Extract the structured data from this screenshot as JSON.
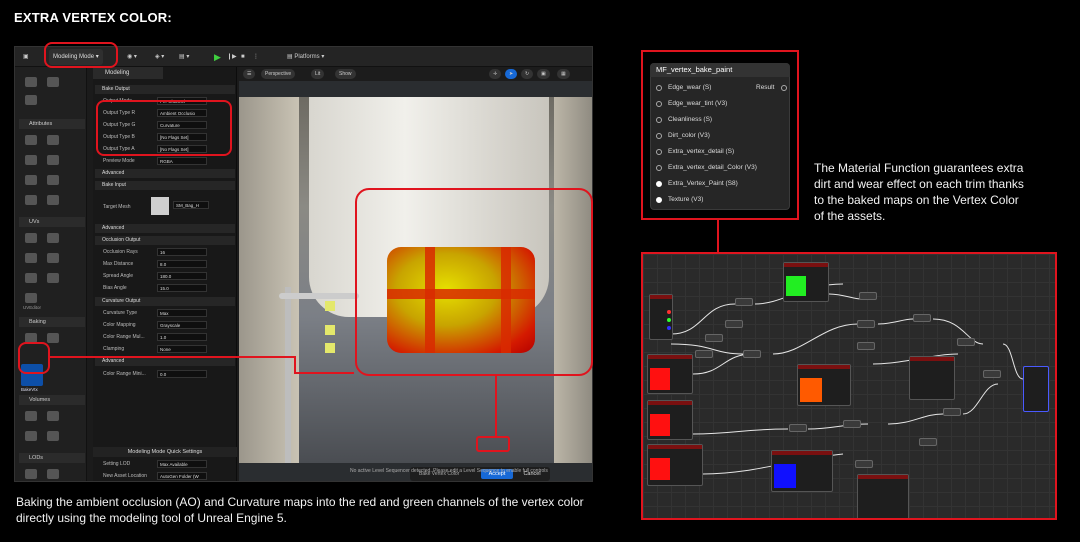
{
  "title": "EXTRA VERTEX COLOR:",
  "captions": {
    "bottom": "Baking the ambient occlusion (AO) and Curvature maps into the red and green channels of the vertex color directly using the modeling tool of Unreal Engine 5.",
    "right": "The Material Function guarantees extra dirt and wear effect on each trim thanks to the baked maps on the Vertex Color of the assets."
  },
  "toolbar": {
    "mode": "Modeling Mode",
    "platforms": "Platforms"
  },
  "modes_panel": {
    "groups": [
      "Attributes",
      "UVs",
      "Baking",
      "Volumes",
      "LODs"
    ],
    "active_tool": "BakeVtx",
    "tool_labels": {
      "unwrap": "UVEditor"
    }
  },
  "modeling_panel": {
    "tab": "Modeling",
    "sections": {
      "bake_output": "Bake Output",
      "advanced1": "Advanced",
      "bake_input": "Bake Input",
      "advanced2": "Advanced",
      "occlusion_output": "Occlusion Output",
      "curvature_output": "Curvature Output",
      "advanced3": "Advanced"
    },
    "rows": {
      "output_mode": {
        "label": "Output Mode",
        "value": "Per Channel"
      },
      "output_type_r": {
        "label": "Output Type R",
        "value": "Ambient Occlusio"
      },
      "output_type_g": {
        "label": "Output Type G",
        "value": "Curvature"
      },
      "output_type_b": {
        "label": "Output Type B",
        "value": "[No Flags Set]"
      },
      "output_type_a": {
        "label": "Output Type A",
        "value": "[No Flags Set]"
      },
      "preview_mode": {
        "label": "Preview Mode",
        "value": "RGBA"
      },
      "target_mesh": {
        "label": "Target Mesh",
        "value": "SM_Bag_H"
      },
      "occlusion_rays": {
        "label": "Occlusion Rays",
        "value": "16"
      },
      "max_distance": {
        "label": "Max Distance",
        "value": "8.0"
      },
      "spread_angle": {
        "label": "Spread Angle",
        "value": "180.0"
      },
      "bias_angle": {
        "label": "Bias Angle",
        "value": "15.0"
      },
      "curvature_type": {
        "label": "Curvature Type",
        "value": "Max"
      },
      "color_mapping": {
        "label": "Color Mapping",
        "value": "Grayscale"
      },
      "color_range": {
        "label": "Color Range Mul...",
        "value": "1.0"
      },
      "clamping": {
        "label": "Clamping",
        "value": "None"
      },
      "color_range_min": {
        "label": "Color Range Mini...",
        "value": "0.0"
      }
    },
    "quick_settings": {
      "header": "Modeling Mode Quick Settings",
      "setting_lod_label": "Setting LOD",
      "setting_lod_value": "Max Available",
      "asset_location_label": "New Asset Location",
      "asset_location_value": "AutoGen Folder (W"
    }
  },
  "viewport": {
    "perspective": "Perspective",
    "lit": "Lit",
    "show": "Show",
    "bake_vertex_color": "Bake Vertex Color",
    "accept": "Accept",
    "cancel": "Cancel",
    "status": "No active Level Sequencer detected. Please edit a Level Sequence to enable full controls"
  },
  "material_function": {
    "name": "MF_vertex_bake_paint",
    "output": "Result",
    "inputs": [
      "Edge_wear (S)",
      "Edge_wear_tint (V3)",
      "Cleanliness (S)",
      "Dirt_color (V3)",
      "Extra_vertex_detail (S)",
      "Extra_vertex_detail_Color (V3)",
      "Extra_Vertex_Paint (S8)",
      "Texture (V3)"
    ]
  },
  "colors": {
    "highlight": "#e0141e",
    "accept": "#1769d6",
    "swatch_green": "#22ee22",
    "swatch_red": "#ff1010",
    "swatch_orange": "#ff5a00",
    "swatch_blue": "#1010ff"
  }
}
